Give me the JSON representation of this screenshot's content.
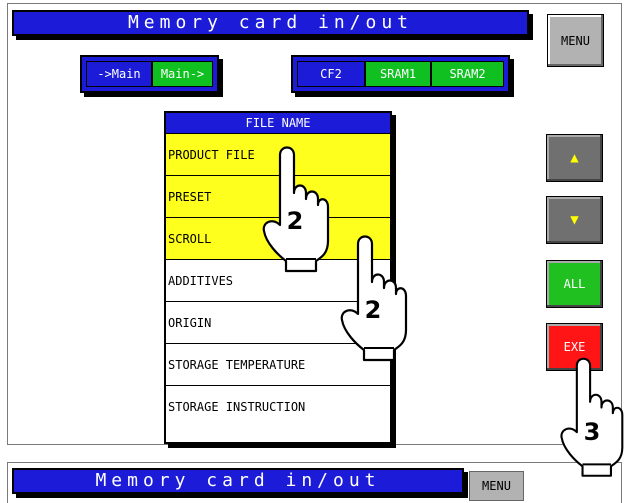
{
  "window": {
    "title": "Memory card in/out",
    "menu_label": "MENU"
  },
  "direction_buttons": [
    {
      "label": "->Main",
      "color": "#1c1cd8"
    },
    {
      "label": "Main->",
      "color": "#10c020"
    }
  ],
  "media_buttons": [
    {
      "label": "CF2",
      "color": "#1c1cd8"
    },
    {
      "label": "SRAM1",
      "color": "#10c020"
    },
    {
      "label": "SRAM2",
      "color": "#10c020"
    }
  ],
  "file_list": {
    "header": "FILE NAME",
    "items": [
      {
        "label": "PRODUCT FILE",
        "selected": true
      },
      {
        "label": "PRESET",
        "selected": true
      },
      {
        "label": "SCROLL",
        "selected": true
      },
      {
        "label": "ADDITIVES",
        "selected": false
      },
      {
        "label": "ORIGIN",
        "selected": false
      },
      {
        "label": "STORAGE TEMPERATURE",
        "selected": false
      },
      {
        "label": "STORAGE INSTRUCTION",
        "selected": false
      }
    ]
  },
  "side_buttons": {
    "up": {
      "icon": "triangle-up-icon",
      "glyph": "▲"
    },
    "down": {
      "icon": "triangle-down-icon",
      "glyph": "▼"
    },
    "all": "ALL",
    "exe": "EXE"
  },
  "step_markers": [
    "2",
    "2",
    "3"
  ],
  "second_window": {
    "title": "Memory card in/out",
    "menu_label": "MENU"
  }
}
